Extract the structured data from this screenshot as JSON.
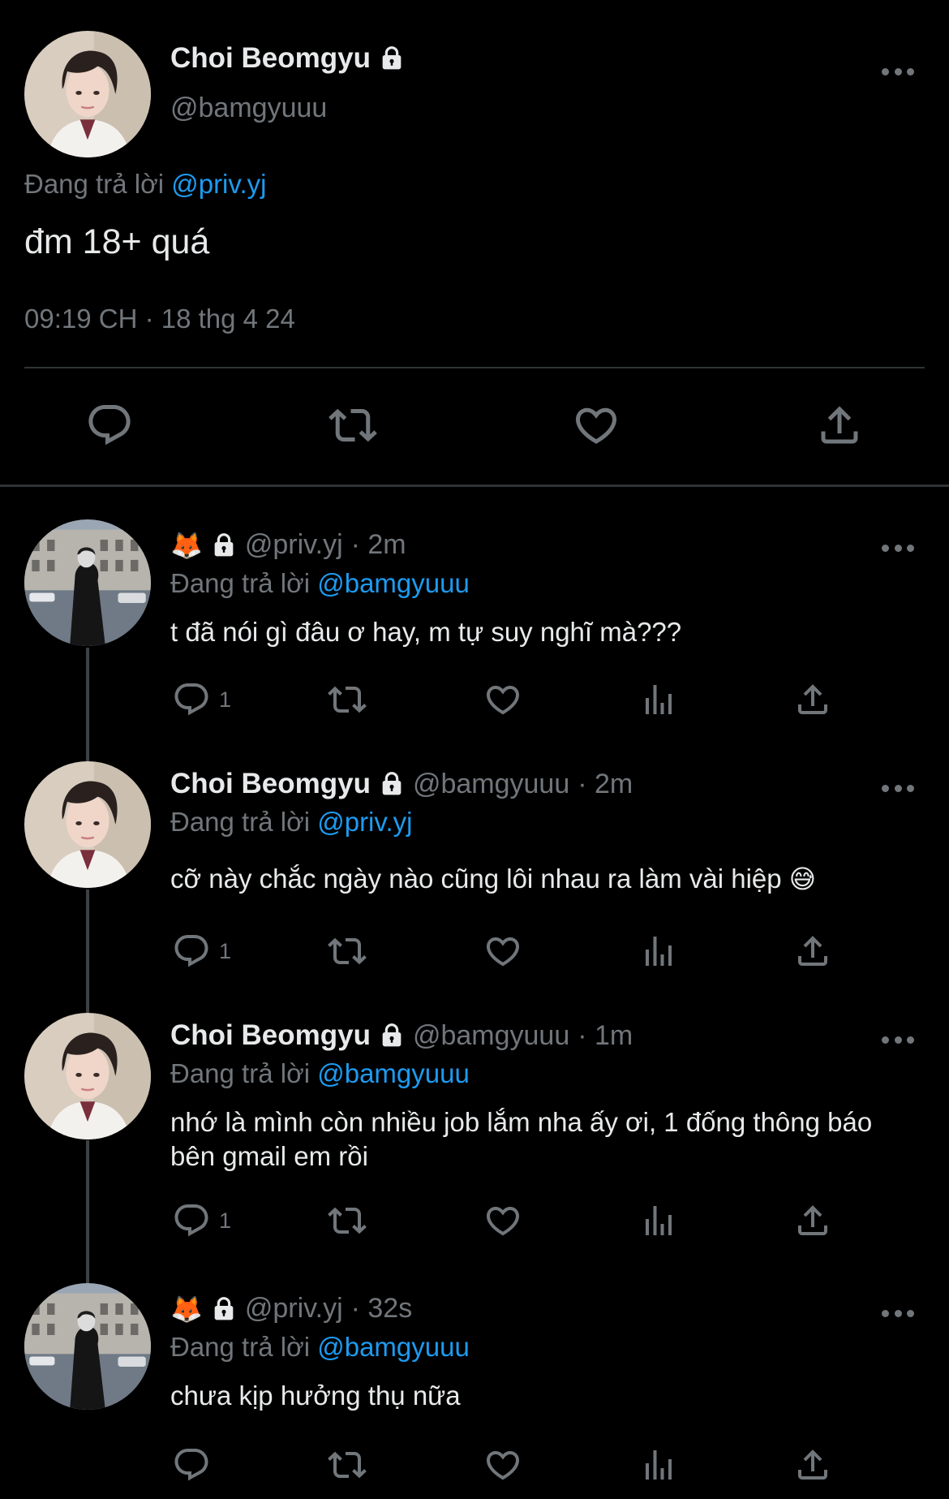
{
  "main": {
    "name": "Choi Beomgyu",
    "handle": "@bamgyuuu",
    "replying_prefix": "Đang trả lời",
    "replying_to": "@priv.yj",
    "text": "đm 18+ quá",
    "timestamp": "09:19 CH · 18 thg 4 24",
    "icons": [
      "reply-icon",
      "retweet-icon",
      "like-icon",
      "share-icon"
    ]
  },
  "replies": [
    {
      "name": "",
      "emoji": "🦊",
      "handle": "@priv.yj",
      "time": "· 2m",
      "replying_prefix": "Đang trả lời",
      "replying_to": "@bamgyuuu",
      "text": "t đã nói gì đâu ơ hay, m tự suy nghĩ mà???",
      "reply_count": "1"
    },
    {
      "name": "Choi Beomgyu",
      "handle": "@bamgyuuu",
      "time": "· 2m",
      "replying_prefix": "Đang trả lời",
      "replying_to": "@priv.yj",
      "text": "cỡ này chắc ngày nào cũng lôi nhau ra làm vài hiệp",
      "text_emoji": "😅",
      "reply_count": "1"
    },
    {
      "name": "Choi Beomgyu",
      "handle": "@bamgyuuu",
      "time": "· 1m",
      "replying_prefix": "Đang trả lời",
      "replying_to": "@bamgyuuu",
      "text": "nhớ là mình còn nhiều job lắm nha ấy ơi, 1 đống thông báo bên gmail em rồi",
      "reply_count": "1"
    },
    {
      "name": "",
      "emoji": "🦊",
      "handle": "@priv.yj",
      "time": "· 32s",
      "replying_prefix": "Đang trả lời",
      "replying_to": "@bamgyuuu",
      "text": "chưa kịp hưởng thụ nữa",
      "reply_count": ""
    }
  ],
  "colors": {
    "background": "#000000",
    "text": "#e7e9ea",
    "secondary": "#71767b",
    "accent": "#1d9bf0",
    "divider": "#2f3336"
  }
}
